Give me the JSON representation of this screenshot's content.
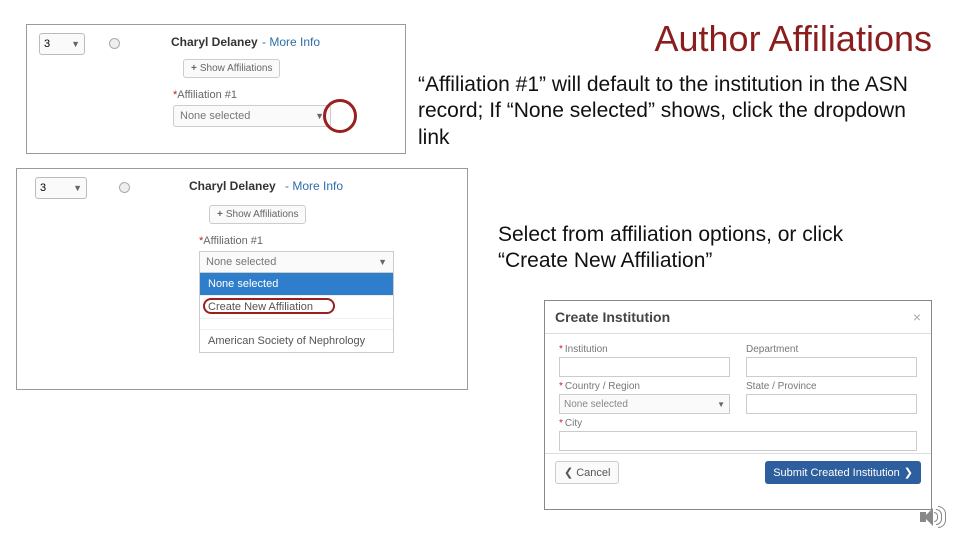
{
  "slide": {
    "title": "Author Affiliations",
    "para1": "“Affiliation #1” will default to the institution in the ASN record; If “None selected” shows, click the dropdown link",
    "para2": "Select from affiliation options, or click “Create New Affiliation”"
  },
  "panel1": {
    "order": "3",
    "author": "Charyl Delaney",
    "more": "- More Info",
    "show_btn": "Show Affiliations",
    "aff_label": "Affiliation #1",
    "none_selected": "None selected"
  },
  "panel2": {
    "order": "3",
    "author": "Charyl Delaney",
    "more": "- More Info",
    "show_btn": "Show Affiliations",
    "aff_label": "Affiliation #1",
    "dd_current": "None selected",
    "dd_items": [
      "None selected",
      "Create New Affiliation",
      "",
      "American Society of Nephrology"
    ]
  },
  "modal": {
    "title": "Create Institution",
    "fields": {
      "institution": "Institution",
      "department": "Department",
      "country": "Country / Region",
      "state": "State / Province",
      "city": "City"
    },
    "country_placeholder": "None selected",
    "cancel": "Cancel",
    "submit": "Submit Created Institution"
  }
}
